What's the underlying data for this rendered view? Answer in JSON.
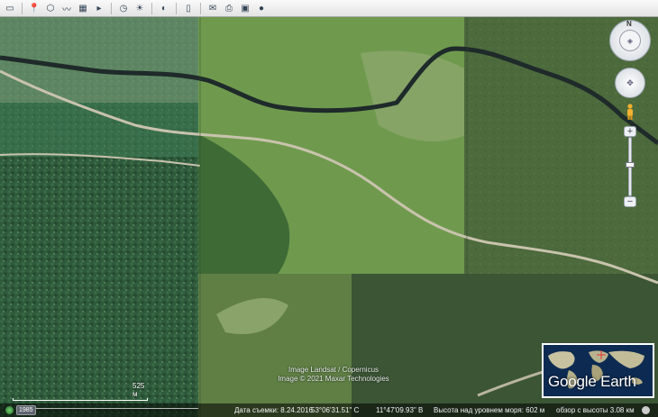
{
  "toolbar": {
    "buttons": [
      {
        "icon": "sidebar-icon"
      },
      {
        "icon": "placemark-icon"
      },
      {
        "icon": "polygon-icon"
      },
      {
        "icon": "path-icon"
      },
      {
        "icon": "overlay-icon"
      },
      {
        "icon": "tour-icon"
      },
      {
        "icon": "historical-imagery-icon"
      },
      {
        "icon": "sunlight-icon"
      },
      {
        "icon": "planets-icon"
      },
      {
        "icon": "ruler-icon"
      },
      {
        "icon": "email-icon"
      },
      {
        "icon": "print-icon"
      },
      {
        "icon": "save-image-icon"
      },
      {
        "icon": "maps-icon"
      }
    ]
  },
  "compass": {
    "north_label": "N"
  },
  "map": {
    "copyright_line1": "Image Landsat / Copernicus",
    "copyright_line2": "Image © 2021 Maxar Technologies",
    "scale_label": "525 м"
  },
  "logo": {
    "text": "Google Earth"
  },
  "status": {
    "year": "1985",
    "date": "Дата съемки: 8.24.2016",
    "lat": "53°06'31.51\" С",
    "lon": "11°47'09.93\" В",
    "elevation": "Высота над уровнем моря:   602 м",
    "eye_alt": "обзор с высоты   3.08 км"
  },
  "colors": {
    "river": "#1f2a2a",
    "road": "#c9c3ad",
    "forest": "#2f5a3b",
    "meadow": "#7c9a5a"
  }
}
